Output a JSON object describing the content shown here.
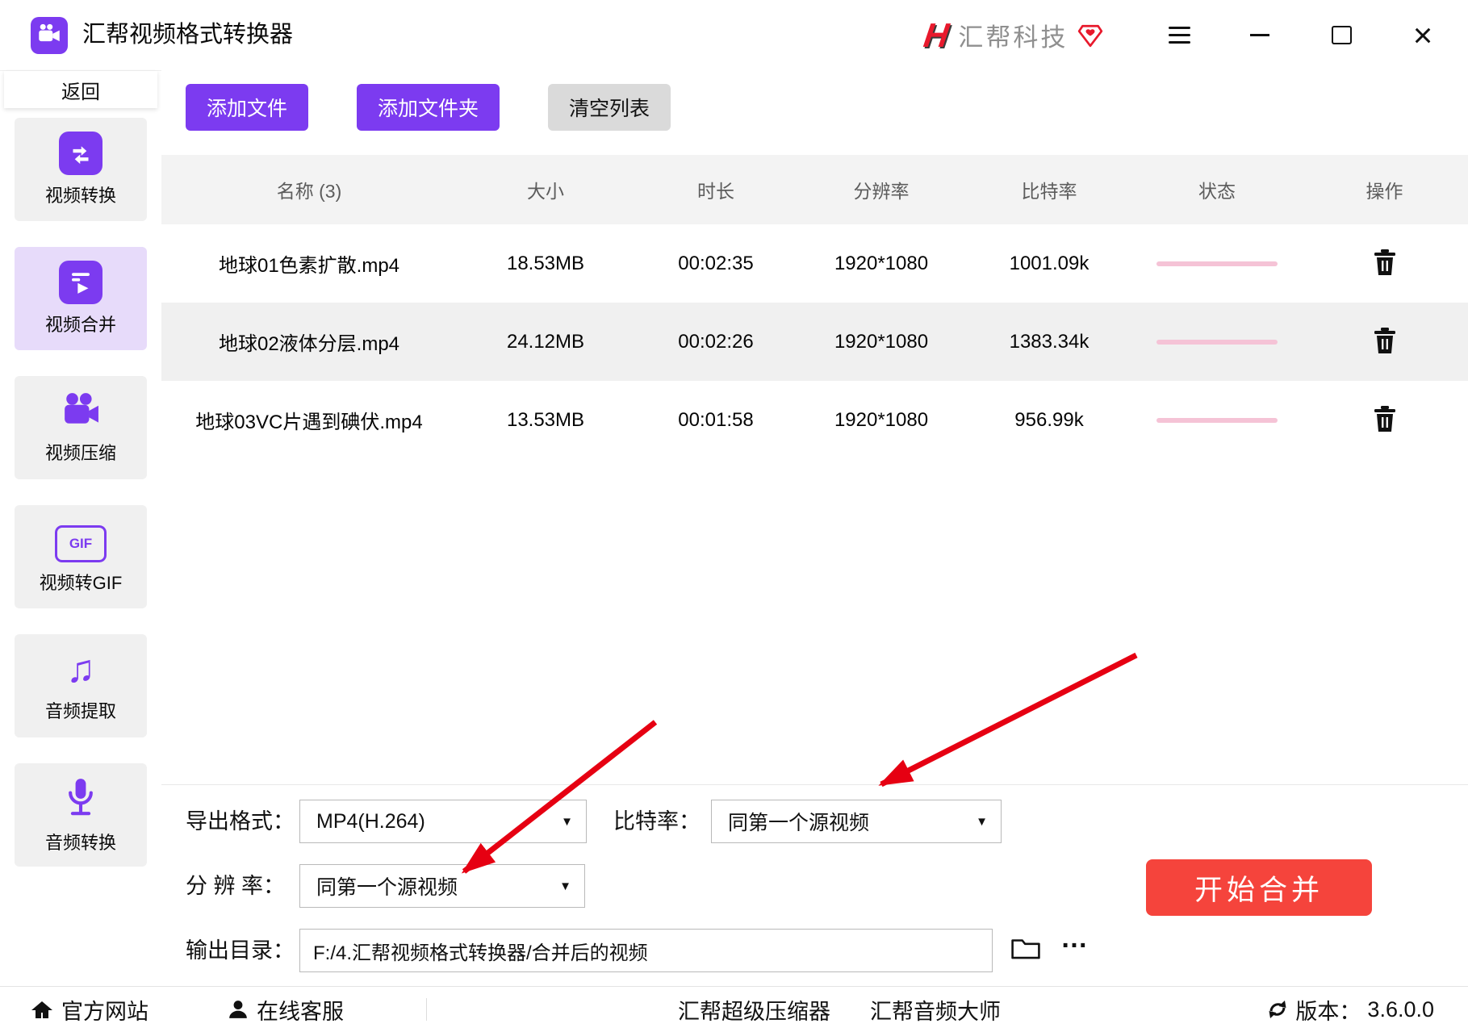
{
  "colors": {
    "accent_purple": "#7C3BF0",
    "start_button_red": "#F5443C",
    "annotation_arrow_red": "#E60012",
    "progress_pink": "#F5C3D6",
    "brand_red": "#E8192C",
    "selected_nav_bg": "#E7DBFA"
  },
  "titlebar": {
    "app_title": "汇帮视频格式转换器",
    "brand_logo_letter": "H",
    "brand_name": "汇帮科技"
  },
  "sidebar": {
    "back": "返回",
    "gif_icon_text": "GIF",
    "items": [
      {
        "label": "视频转换"
      },
      {
        "label": "视频合并"
      },
      {
        "label": "视频压缩"
      },
      {
        "label": "视频转GIF"
      },
      {
        "label": "音频提取"
      },
      {
        "label": "音频转换"
      }
    ]
  },
  "toolbar": {
    "add_file": "添加文件",
    "add_folder": "添加文件夹",
    "clear_list": "清空列表"
  },
  "table": {
    "headers": [
      "名称 (3)",
      "大小",
      "时长",
      "分辨率",
      "比特率",
      "状态",
      "操作"
    ],
    "rows": [
      {
        "name": "地球01色素扩散.mp4",
        "size": "18.53MB",
        "duration": "00:02:35",
        "resolution": "1920*1080",
        "bitrate": "1001.09k"
      },
      {
        "name": "地球02液体分层.mp4",
        "size": "24.12MB",
        "duration": "00:02:26",
        "resolution": "1920*1080",
        "bitrate": "1383.34k"
      },
      {
        "name": "地球03VC片遇到碘伏.mp4",
        "size": "13.53MB",
        "duration": "00:01:58",
        "resolution": "1920*1080",
        "bitrate": "956.99k"
      }
    ]
  },
  "settings": {
    "export_format_label": "导出格式：",
    "export_format_value": "MP4(H.264)",
    "bitrate_label": "比特率：",
    "bitrate_value": "同第一个源视频",
    "resolution_label": "分 辨 率：",
    "resolution_value": "同第一个源视频",
    "output_dir_label": "输出目录：",
    "output_dir_value": "F:/4.汇帮视频格式转换器/合并后的视频",
    "more_label": "…",
    "start_merge": "开始合并"
  },
  "statusbar": {
    "official_site": "官方网站",
    "online_service": "在线客服",
    "super_compressor": "汇帮超级压缩器",
    "audio_master": "汇帮音频大师",
    "version_label": "版本：",
    "version_value": "3.6.0.0"
  }
}
